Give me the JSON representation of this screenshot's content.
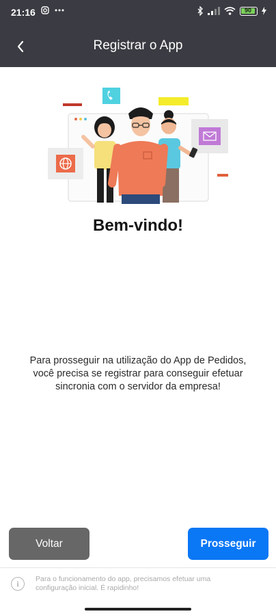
{
  "status_bar": {
    "time": "21:16",
    "battery_level": "90"
  },
  "app_bar": {
    "title": "Registrar o App"
  },
  "main": {
    "welcome": "Bem-vindo!",
    "description": "Para prosseguir na utilização do App de Pedidos, você precisa se registrar para conseguir efetuar sincronia com o servidor da empresa!"
  },
  "actions": {
    "back_label": "Voltar",
    "next_label": "Prosseguir"
  },
  "footer": {
    "info_text": "Para o funcionamento do app, precisamos efetuar uma configuração inicial. É rapidinho!"
  },
  "colors": {
    "bar": "#3b3c43",
    "primary": "#0a77f5",
    "secondary_button": "#676767"
  }
}
